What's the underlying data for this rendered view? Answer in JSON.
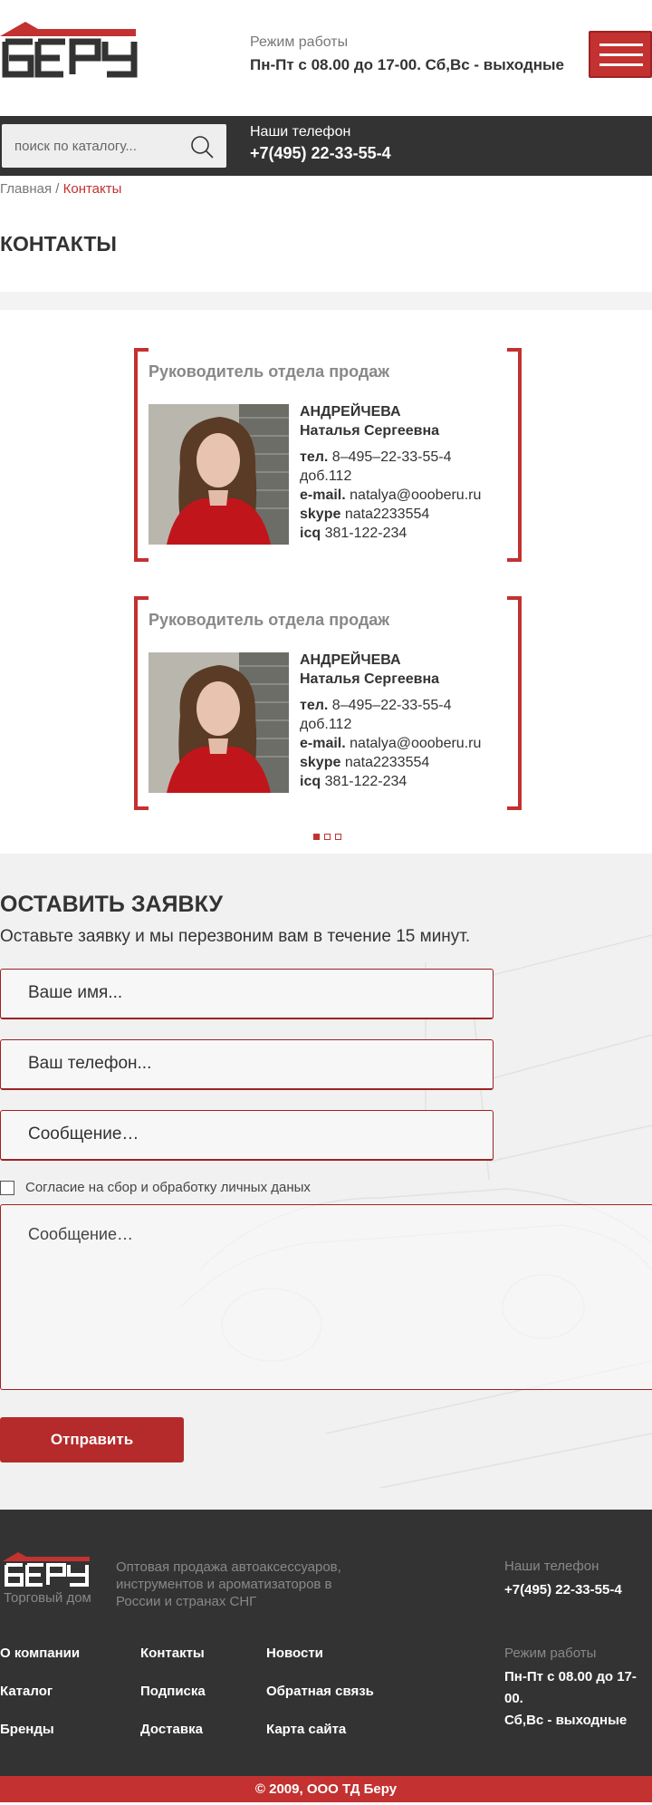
{
  "header": {
    "logo_text": "БЕРУ",
    "schedule_label": "Режим работы",
    "schedule_value": "Пн-Пт с 08.00 до 17-00. Сб,Вс - выходные"
  },
  "darkbar": {
    "search_placeholder": "поиск по каталогу...",
    "phone_label": "Наши телефон",
    "phone_value": "+7(495) 22-33-55-4"
  },
  "breadcrumb": {
    "home": "Главная",
    "separator": " / ",
    "current": "Контакты"
  },
  "page_title": "КОНТАКТЫ",
  "cards": [
    {
      "role": "Руководитель отдела продаж",
      "surname": "АНДРЕЙЧЕВА",
      "name": "Наталья Сергеевна",
      "tel_label": "тел.",
      "tel": "8–495–22-33-55-4",
      "ext": "доб.112",
      "email_label": "e-mail.",
      "email": "natalya@oooberu.ru",
      "skype_label": "skype",
      "skype": "nata2233554",
      "icq_label": "icq",
      "icq": "381-122-234"
    },
    {
      "role": "Руководитель отдела продаж",
      "surname": "АНДРЕЙЧЕВА",
      "name": "Наталья Сергеевна",
      "tel_label": "тел.",
      "tel": "8–495–22-33-55-4",
      "ext": "доб.112",
      "email_label": "e-mail.",
      "email": "natalya@oooberu.ru",
      "skype_label": "skype",
      "skype": "nata2233554",
      "icq_label": "icq",
      "icq": "381-122-234"
    }
  ],
  "slider": {
    "active_index": 0,
    "count": 3
  },
  "form": {
    "title": "ОСТАВИТЬ ЗАЯВКУ",
    "subtitle": "Оставьте заявку и мы перезвоним вам в течение 15 минут.",
    "name_placeholder": "Ваше имя...",
    "phone_placeholder": "Ваш телефон...",
    "message_placeholder": "Сообщение…",
    "agree_label": "Согласие на сбор и обработку личных даных",
    "textarea_placeholder": "Сообщение…",
    "submit_label": "Отправить"
  },
  "footer": {
    "logo_text": "БЕРУ",
    "logo_sub": "Торговый дом",
    "description": "Оптовая продажа автоаксессуаров, инструментов и ароматизаторов в России и странах СНГ",
    "nav_col1": [
      "О компании",
      "Каталог",
      "Бренды"
    ],
    "nav_col2": [
      "Контакты",
      "Подписка",
      "Доставка"
    ],
    "nav_col3": [
      "Новости",
      "Обратная связь",
      "Карта сайта"
    ],
    "phone_label": "Наши телефон",
    "phone_value": "+7(495) 22-33-55-4",
    "schedule_label": "Режим работы",
    "schedule_line1": "Пн-Пт с 08.00 до 17-00.",
    "schedule_line2": "Сб,Вс - выходные"
  },
  "copyright": "© 2009, ООО ТД Беру",
  "colors": {
    "accent": "#c33131",
    "dark": "#333333"
  }
}
